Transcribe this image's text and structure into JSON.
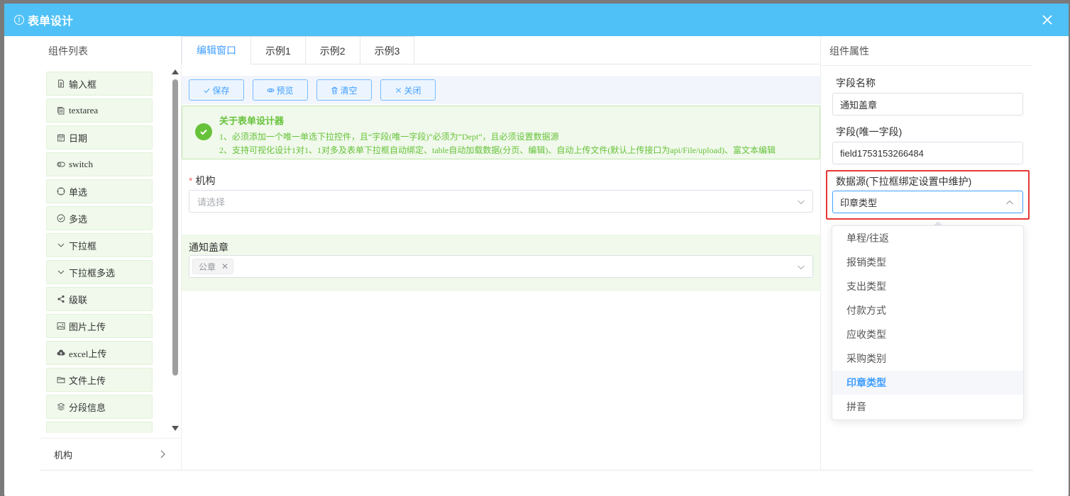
{
  "dialog": {
    "title": "表单设计",
    "header_color": "#4fc1f6"
  },
  "left_panel": {
    "title": "组件列表",
    "items": [
      {
        "label": "输入框",
        "icon": "document-icon"
      },
      {
        "label": "textarea",
        "icon": "copy-icon"
      },
      {
        "label": "日期",
        "icon": "calendar-icon"
      },
      {
        "label": "switch",
        "icon": "toggle-icon"
      },
      {
        "label": "单选",
        "icon": "radio-icon"
      },
      {
        "label": "多选",
        "icon": "check-circle-icon"
      },
      {
        "label": "下拉框",
        "icon": "chevron-down-icon"
      },
      {
        "label": "下拉框多选",
        "icon": "chevron-down-icon"
      },
      {
        "label": "级联",
        "icon": "share-icon"
      },
      {
        "label": "图片上传",
        "icon": "picture-icon"
      },
      {
        "label": "excel上传",
        "icon": "cloud-upload-icon"
      },
      {
        "label": "文件上传",
        "icon": "folder-icon"
      },
      {
        "label": "分段信息",
        "icon": "layers-icon"
      }
    ],
    "footer_label": "机构"
  },
  "tabs": [
    {
      "label": "编辑窗口",
      "active": true
    },
    {
      "label": "示例1",
      "active": false
    },
    {
      "label": "示例2",
      "active": false
    },
    {
      "label": "示例3",
      "active": false
    }
  ],
  "toolbar": {
    "save": "保存",
    "preview": "预览",
    "clear": "清空",
    "close": "关闭"
  },
  "alert": {
    "title": "关于表单设计器",
    "line1": "1、必须添加一个唯一单选下拉控件，且“字段(唯一字段)”必须为“Dept”，且必须设置数据源",
    "line2": "2、支持可视化设计1对1、1对多及表单下拉框自动绑定、table自动加载数据(分页、编辑)、自动上传文件(默认上传接口为api/File/upload)、富文本编辑"
  },
  "form": {
    "field1_label": "机构",
    "field1_placeholder": "请选择",
    "field2_label": "通知盖章",
    "field2_tag": "公章"
  },
  "right_panel": {
    "title": "组件属性",
    "name_label": "字段名称",
    "name_value": "通知盖章",
    "field_label": "字段(唯一字段)",
    "field_value": "field1753153266484",
    "source_label": "数据源(下拉框绑定设置中维护)",
    "source_value": "印章类型"
  },
  "dropdown": {
    "options": [
      {
        "label": "单程/往返",
        "selected": false
      },
      {
        "label": "报销类型",
        "selected": false
      },
      {
        "label": "支出类型",
        "selected": false
      },
      {
        "label": "付款方式",
        "selected": false
      },
      {
        "label": "应收类型",
        "selected": false
      },
      {
        "label": "采购类别",
        "selected": false
      },
      {
        "label": "印章类型",
        "selected": true
      },
      {
        "label": "拼音",
        "selected": false
      }
    ]
  }
}
